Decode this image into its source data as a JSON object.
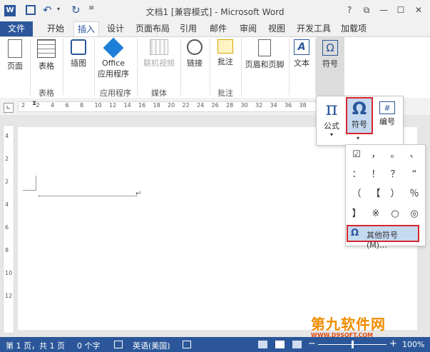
{
  "window": {
    "title": "文档1 [兼容模式] - Microsoft Word",
    "help": "?",
    "controls": [
      "⧉",
      "—",
      "☐",
      "✕"
    ]
  },
  "tabs": [
    "文件",
    "开始",
    "插入",
    "设计",
    "页面布局",
    "引用",
    "邮件",
    "审阅",
    "视图",
    "开发工具",
    "加载项"
  ],
  "ribbon": {
    "page": "页面",
    "table": "表格",
    "illustration": "插图",
    "office_apps_1": "Office",
    "office_apps_2": "应用程序",
    "online_video": "联机视频",
    "link": "链接",
    "comment": "批注",
    "header_footer": "页眉和页脚",
    "text": "文本",
    "symbols": "符号",
    "groups": {
      "table": "表格",
      "apps": "应用程序",
      "media": "媒体",
      "comments": "批注"
    }
  },
  "ruler": {
    "numbers": [
      "2",
      "2",
      "4",
      "6",
      "8",
      "10",
      "12",
      "14",
      "16",
      "18",
      "20",
      "22",
      "24",
      "26",
      "28",
      "30",
      "32",
      "34",
      "36",
      "38"
    ]
  },
  "vruler": {
    "numbers": [
      "4",
      "2",
      "2",
      "4",
      "6",
      "8",
      "10",
      "12"
    ]
  },
  "symbol_menu": {
    "equation": "公式",
    "symbol": "符号",
    "number": "编号",
    "grid": [
      "☑",
      "，",
      "。",
      "、",
      "：",
      "！",
      "？",
      "“",
      "（",
      "【",
      "）",
      "％",
      "】",
      "※",
      "○",
      "◎"
    ],
    "more": "其他符号(M)..."
  },
  "statusbar": {
    "page": "第 1 页，共 1 页",
    "words": "0 个字",
    "language": "英语(美国)",
    "zoom": "100%"
  },
  "watermark": {
    "main": "第九软件网",
    "sub": "WWW.D9SOFT.COM"
  },
  "colors": {
    "accent": "#2b579a",
    "highlight": "#d6e4f5",
    "redbox": "#d9262c"
  }
}
